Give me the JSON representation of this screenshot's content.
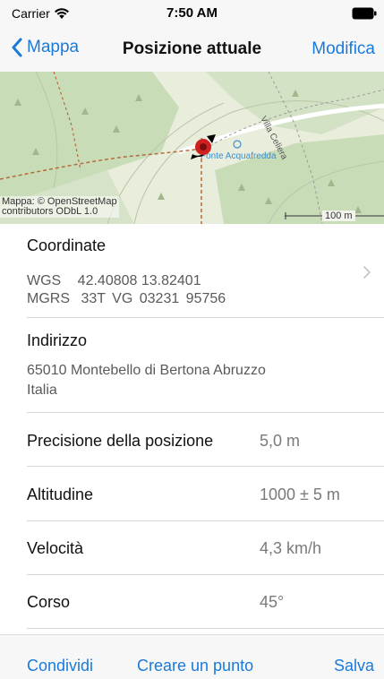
{
  "status_bar": {
    "carrier": "Carrier",
    "time": "7:50 AM"
  },
  "nav": {
    "back_label": "Mappa",
    "title": "Posizione attuale",
    "edit_label": "Modifica"
  },
  "map": {
    "place_label": "Fonte Acquafredda",
    "road_label": "Villa Celiera",
    "attribution_line1": "Mappa: © OpenStreetMap",
    "attribution_line2": "contributors ODbL 1.0",
    "scale_label": "100 m"
  },
  "coordinates": {
    "header": "Coordinate",
    "wgs_label": "WGS",
    "wgs_value": "42.40808 13.82401",
    "mgrs_label": "MGRS",
    "mgrs_value": "33T VG 03231 95756"
  },
  "address": {
    "header": "Indirizzo",
    "line1": "65010 Montebello di Bertona Abruzzo",
    "line2": "Italia"
  },
  "details": [
    {
      "label": "Precisione della posizione",
      "value": "5,0 m"
    },
    {
      "label": "Altitudine",
      "value": "1000 ± 5 m"
    },
    {
      "label": "Velocità",
      "value": "4,3 km/h"
    },
    {
      "label": "Corso",
      "value": "45°"
    }
  ],
  "toolbar": {
    "share_label": "Condividi",
    "create_point_label": "Creare un punto",
    "save_label": "Salva"
  },
  "colors": {
    "accent": "#1a7ad9",
    "marker": "#d0201f",
    "forest": "#c9dcb8",
    "meadow": "#e8eddc"
  }
}
